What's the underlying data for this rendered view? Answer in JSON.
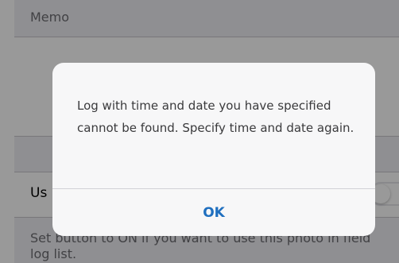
{
  "background": {
    "memo_label": "Memo",
    "use_label": "Us",
    "footer_text": "Set button to ON if you want to use this photo in field log list."
  },
  "alert": {
    "message": "Log with time and date you have specified cannot be found. Specify time and date again.",
    "ok_label": "OK"
  },
  "colors": {
    "accent": "#1f6fbf",
    "dim_overlay": "rgba(0,0,0,0.4)"
  }
}
